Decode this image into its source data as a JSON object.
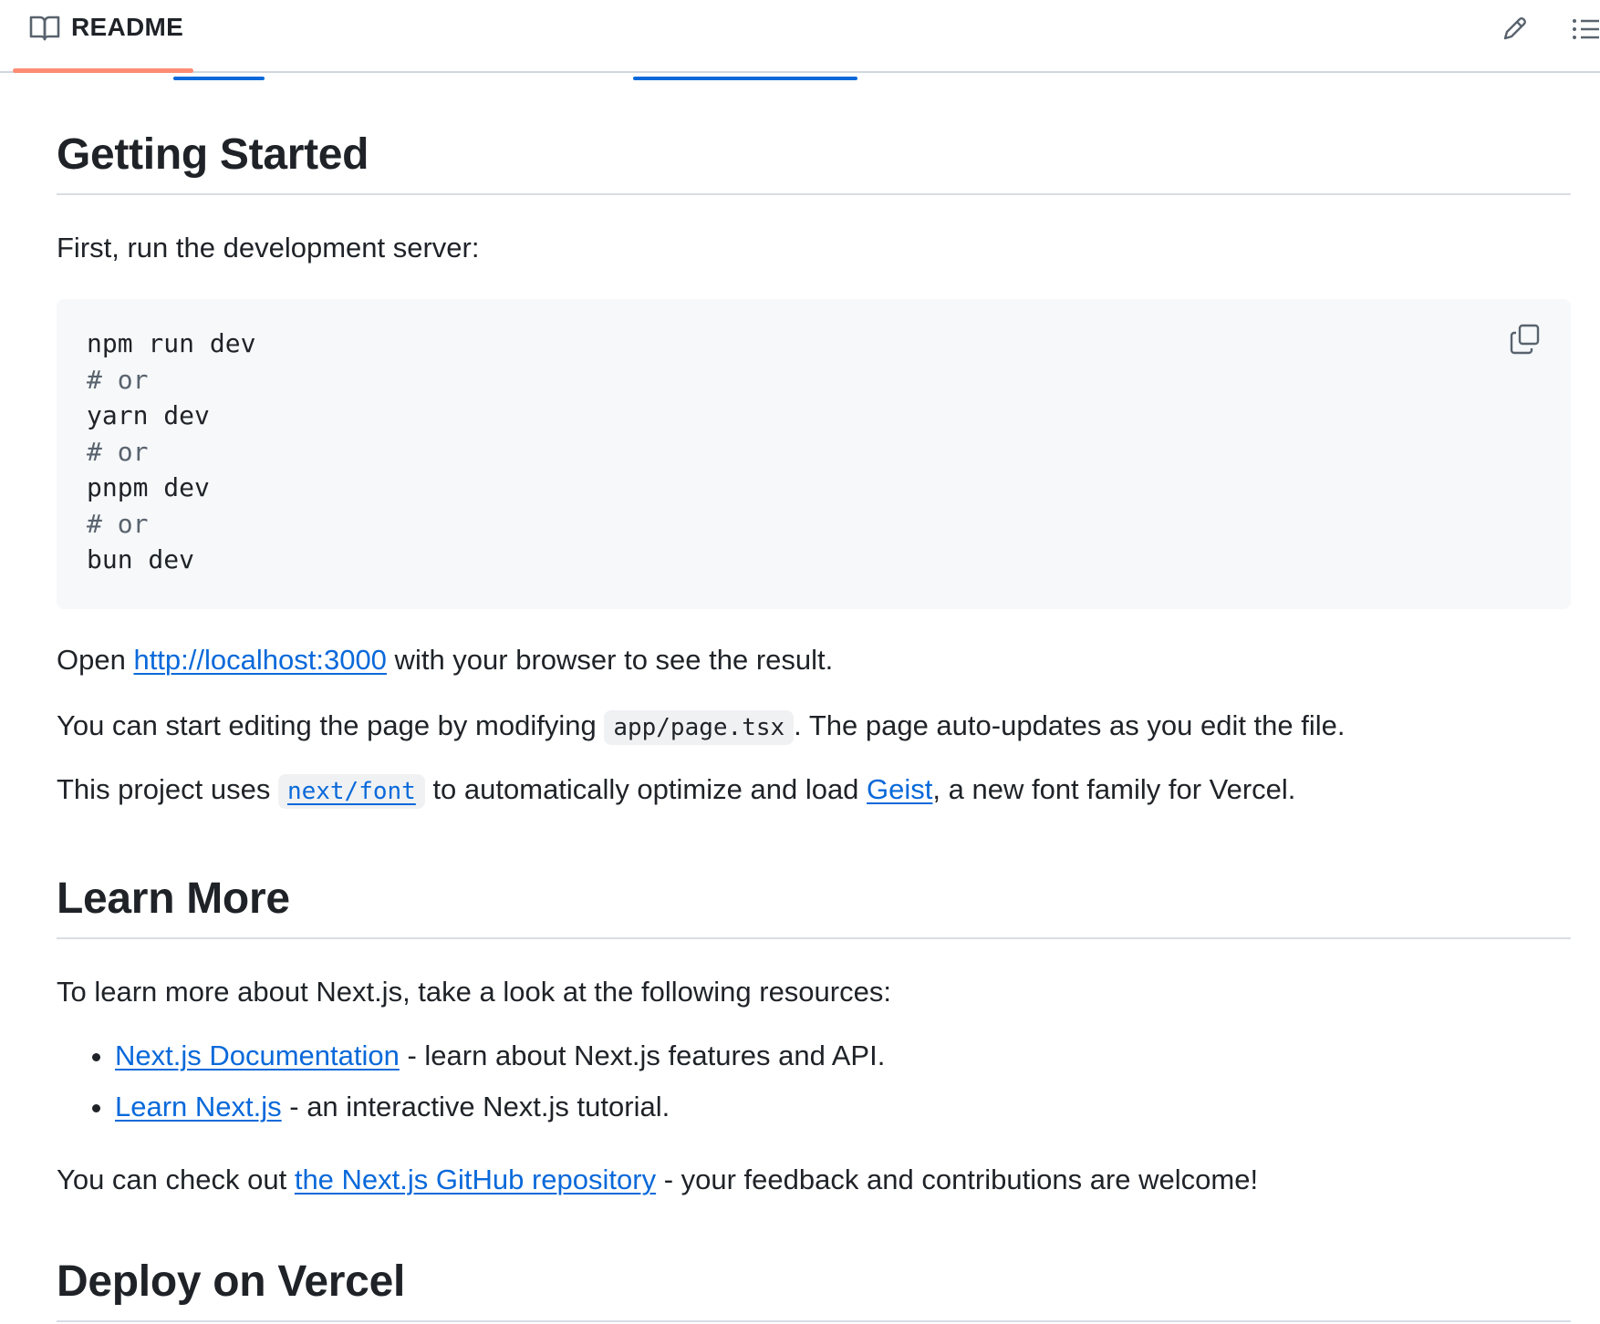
{
  "header": {
    "tab_label": "README"
  },
  "sections": {
    "getting_started": {
      "heading": "Getting Started",
      "intro": "First, run the development server:",
      "code_lines": [
        {
          "text": "npm run dev",
          "comment": false
        },
        {
          "text": "# or",
          "comment": true
        },
        {
          "text": "yarn dev",
          "comment": false
        },
        {
          "text": "# or",
          "comment": true
        },
        {
          "text": "pnpm dev",
          "comment": false
        },
        {
          "text": "# or",
          "comment": true
        },
        {
          "text": "bun dev",
          "comment": false
        }
      ],
      "open": {
        "before": "Open ",
        "link": "http://localhost:3000",
        "after": " with your browser to see the result."
      },
      "edit": {
        "before": "You can start editing the page by modifying ",
        "code": "app/page.tsx",
        "after": ". The page auto-updates as you edit the file."
      },
      "font": {
        "before": "This project uses ",
        "code_link": "next/font",
        "middle": " to automatically optimize and load ",
        "link": "Geist",
        "after": ", a new font family for Vercel."
      }
    },
    "learn_more": {
      "heading": "Learn More",
      "intro": "To learn more about Next.js, take a look at the following resources:",
      "items": [
        {
          "link": "Next.js Documentation",
          "text": " - learn about Next.js features and API."
        },
        {
          "link": "Learn Next.js",
          "text": " - an interactive Next.js tutorial."
        }
      ],
      "repo": {
        "before": "You can check out ",
        "link": "the Next.js GitHub repository",
        "after": " - your feedback and contributions are welcome!"
      }
    },
    "deploy": {
      "heading": "Deploy on Vercel"
    }
  },
  "icons": {
    "tab": "book-icon",
    "edit": "pencil-icon",
    "outline": "list-icon",
    "copy": "copy-icon"
  },
  "colors": {
    "link": "#0969da",
    "tab_underline": "#fd8c73",
    "code_bg": "#f6f8fa"
  }
}
